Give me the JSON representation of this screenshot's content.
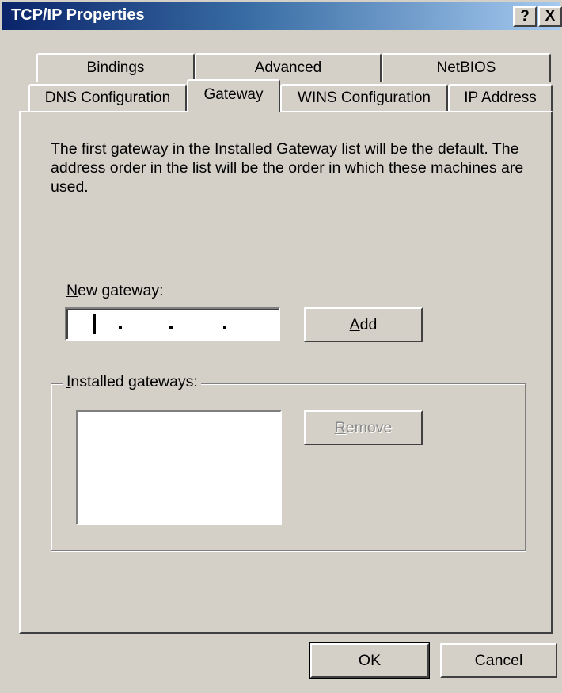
{
  "window": {
    "title": "TCP/IP Properties",
    "help_glyph": "?",
    "close_glyph": "X"
  },
  "tabs": {
    "row1": [
      "Bindings",
      "Advanced",
      "NetBIOS"
    ],
    "row2": [
      "DNS Configuration",
      "Gateway",
      "WINS Configuration",
      "IP Address"
    ],
    "active": "Gateway"
  },
  "gateway_panel": {
    "description": "The first gateway in the Installed Gateway list will be the default. The address order in the list will be the order in which these machines are used.",
    "new_gateway_label": {
      "mnemonic": "N",
      "rest": "ew gateway:"
    },
    "new_gateway_value": "",
    "add_button": {
      "mnemonic": "A",
      "rest": "dd"
    },
    "installed_label": {
      "mnemonic": "I",
      "rest": "nstalled gateways:"
    },
    "installed_items": [],
    "remove_button": {
      "mnemonic": "R",
      "rest": "emove",
      "enabled": false
    }
  },
  "footer": {
    "ok_label": "OK",
    "cancel_label": "Cancel"
  }
}
